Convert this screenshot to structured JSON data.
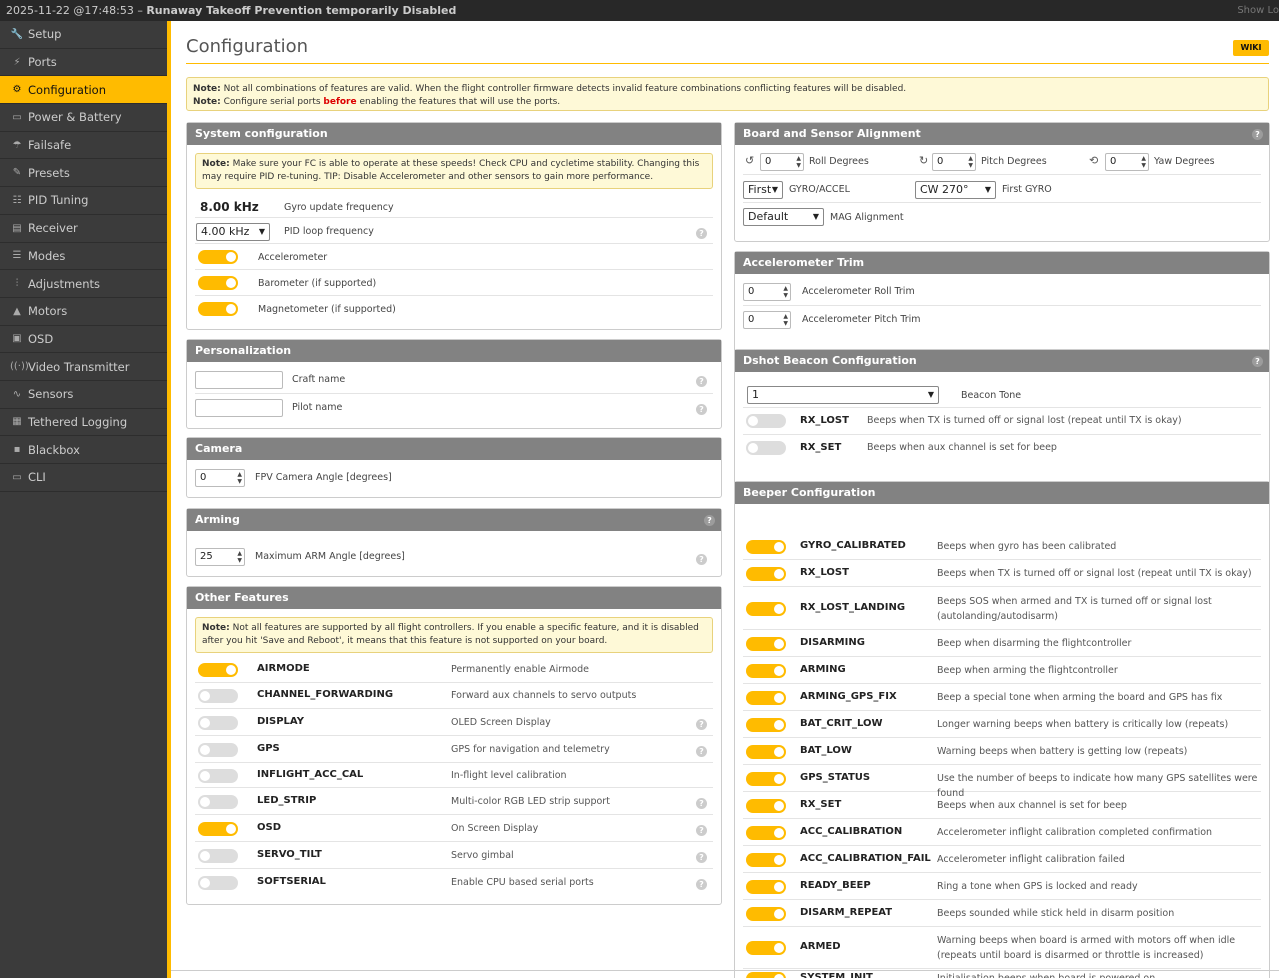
{
  "topbar": {
    "timestamp": "2025-11-22 @17:48:53 –",
    "status": "Runaway Takeoff Prevention temporarily Disabled",
    "show_log": "Show Lo"
  },
  "sidebar": {
    "items": [
      {
        "label": "Setup",
        "icon": "wrench-icon",
        "glyph": "🔧"
      },
      {
        "label": "Ports",
        "icon": "plug-icon",
        "glyph": "⚡"
      },
      {
        "label": "Configuration",
        "icon": "gear-icon",
        "glyph": "⚙"
      },
      {
        "label": "Power & Battery",
        "icon": "battery-icon",
        "glyph": "▭"
      },
      {
        "label": "Failsafe",
        "icon": "parachute-icon",
        "glyph": "☂"
      },
      {
        "label": "Presets",
        "icon": "magic-wand-icon",
        "glyph": "✎"
      },
      {
        "label": "PID Tuning",
        "icon": "sitemap-icon",
        "glyph": "☷"
      },
      {
        "label": "Receiver",
        "icon": "receiver-icon",
        "glyph": "▤"
      },
      {
        "label": "Modes",
        "icon": "modes-icon",
        "glyph": "☰"
      },
      {
        "label": "Adjustments",
        "icon": "sliders-icon",
        "glyph": "⫶"
      },
      {
        "label": "Motors",
        "icon": "motor-icon",
        "glyph": "▲"
      },
      {
        "label": "OSD",
        "icon": "osd-icon",
        "glyph": "▣"
      },
      {
        "label": "Video Transmitter",
        "icon": "broadcast-icon",
        "glyph": "((·))"
      },
      {
        "label": "Sensors",
        "icon": "pulse-icon",
        "glyph": "∿"
      },
      {
        "label": "Tethered Logging",
        "icon": "logging-icon",
        "glyph": "▦"
      },
      {
        "label": "Blackbox",
        "icon": "blackbox-icon",
        "glyph": "▪"
      },
      {
        "label": "CLI",
        "icon": "terminal-icon",
        "glyph": "▭"
      }
    ],
    "active_index": 2
  },
  "page": {
    "title": "Configuration",
    "wiki": "WIKI",
    "note1_bold": "Note:",
    "note1": "Not all combinations of features are valid. When the flight controller firmware detects invalid feature combinations conflicting features will be disabled.",
    "note2_bold": "Note:",
    "note2_pre": "Configure serial ports",
    "note2_red": "before",
    "note2_post": "enabling the features that will use the ports."
  },
  "system": {
    "title": "System configuration",
    "note_bold": "Note:",
    "note": "Make sure your FC is able to operate at these speeds! Check CPU and cycletime stability. Changing this may require PID re-tuning. TIP: Disable Accelerometer and other sensors to gain more performance.",
    "gyro_value": "8.00 kHz",
    "gyro_label": "Gyro update frequency",
    "pid_value": "4.00 kHz",
    "pid_label": "PID loop frequency",
    "toggles": [
      {
        "label": "Accelerometer",
        "on": true
      },
      {
        "label": "Barometer (if supported)",
        "on": true
      },
      {
        "label": "Magnetometer (if supported)",
        "on": true
      }
    ]
  },
  "personalization": {
    "title": "Personalization",
    "craft_label": "Craft name",
    "pilot_label": "Pilot name",
    "craft_value": "",
    "pilot_value": ""
  },
  "camera": {
    "title": "Camera",
    "value": "0",
    "label": "FPV Camera Angle [degrees]"
  },
  "arming": {
    "title": "Arming",
    "value": "25",
    "label": "Maximum ARM Angle [degrees]"
  },
  "features": {
    "title": "Other Features",
    "note_bold": "Note:",
    "note": "Not all features are supported by all flight controllers. If you enable a specific feature, and it is disabled after you hit 'Save and Reboot', it means that this feature is not supported on your board.",
    "items": [
      {
        "name": "AIRMODE",
        "desc": "Permanently enable Airmode",
        "on": true,
        "help": false
      },
      {
        "name": "CHANNEL_FORWARDING",
        "desc": "Forward aux channels to servo outputs",
        "on": false,
        "help": false
      },
      {
        "name": "DISPLAY",
        "desc": "OLED Screen Display",
        "on": false,
        "help": true
      },
      {
        "name": "GPS",
        "desc": "GPS for navigation and telemetry",
        "on": false,
        "help": true
      },
      {
        "name": "INFLIGHT_ACC_CAL",
        "desc": "In-flight level calibration",
        "on": false,
        "help": false
      },
      {
        "name": "LED_STRIP",
        "desc": "Multi-color RGB LED strip support",
        "on": false,
        "help": true
      },
      {
        "name": "OSD",
        "desc": "On Screen Display",
        "on": true,
        "help": true
      },
      {
        "name": "SERVO_TILT",
        "desc": "Servo gimbal",
        "on": false,
        "help": true
      },
      {
        "name": "SOFTSERIAL",
        "desc": "Enable CPU based serial ports",
        "on": false,
        "help": true
      }
    ]
  },
  "alignment": {
    "title": "Board and Sensor Alignment",
    "roll_value": "0",
    "roll_label": "Roll Degrees",
    "pitch_value": "0",
    "pitch_label": "Pitch Degrees",
    "yaw_value": "0",
    "yaw_label": "Yaw Degrees",
    "gyro_select": "First",
    "gyro_label": "GYRO/ACCEL",
    "first_gyro_select": "CW 270°",
    "first_gyro_label": "First GYRO",
    "mag_select": "Default",
    "mag_label": "MAG Alignment"
  },
  "acc_trim": {
    "title": "Accelerometer Trim",
    "roll_value": "0",
    "roll_label": "Accelerometer Roll Trim",
    "pitch_value": "0",
    "pitch_label": "Accelerometer Pitch Trim"
  },
  "dshot": {
    "title": "Dshot Beacon Configuration",
    "tone_value": "1",
    "tone_label": "Beacon Tone",
    "items": [
      {
        "name": "RX_LOST",
        "desc": "Beeps when TX is turned off or signal lost (repeat until TX is okay)",
        "on": false
      },
      {
        "name": "RX_SET",
        "desc": "Beeps when aux channel is set for beep",
        "on": false
      }
    ]
  },
  "beeper": {
    "title": "Beeper Configuration",
    "items": [
      {
        "name": "GYRO_CALIBRATED",
        "desc": "Beeps when gyro has been calibrated",
        "on": true
      },
      {
        "name": "RX_LOST",
        "desc": "Beeps when TX is turned off or signal lost (repeat until TX is okay)",
        "on": true
      },
      {
        "name": "RX_LOST_LANDING",
        "desc": "Beeps SOS when armed and TX is turned off or signal lost (autolanding/autodisarm)",
        "on": true
      },
      {
        "name": "DISARMING",
        "desc": "Beep when disarming the flightcontroller",
        "on": true
      },
      {
        "name": "ARMING",
        "desc": "Beep when arming the flightcontroller",
        "on": true
      },
      {
        "name": "ARMING_GPS_FIX",
        "desc": "Beep a special tone when arming the board and GPS has fix",
        "on": true
      },
      {
        "name": "BAT_CRIT_LOW",
        "desc": "Longer warning beeps when battery is critically low (repeats)",
        "on": true
      },
      {
        "name": "BAT_LOW",
        "desc": "Warning beeps when battery is getting low (repeats)",
        "on": true
      },
      {
        "name": "GPS_STATUS",
        "desc": "Use the number of beeps to indicate how many GPS satellites were found",
        "on": true
      },
      {
        "name": "RX_SET",
        "desc": "Beeps when aux channel is set for beep",
        "on": true
      },
      {
        "name": "ACC_CALIBRATION",
        "desc": "Accelerometer inflight calibration completed confirmation",
        "on": true
      },
      {
        "name": "ACC_CALIBRATION_FAIL",
        "desc": "Accelerometer inflight calibration failed",
        "on": true
      },
      {
        "name": "READY_BEEP",
        "desc": "Ring a tone when GPS is locked and ready",
        "on": true
      },
      {
        "name": "DISARM_REPEAT",
        "desc": "Beeps sounded while stick held in disarm position",
        "on": true
      },
      {
        "name": "ARMED",
        "desc": "Warning beeps when board is armed with motors off when idle (repeats until board is disarmed or throttle is increased)",
        "on": true
      },
      {
        "name": "SYSTEM_INIT",
        "desc": "Initialisation beeps when board is powered on",
        "on": true
      }
    ]
  },
  "colors": {
    "accent": "#ffbb00",
    "sidebar": "#3b3b3b",
    "header": "#828282",
    "note_bg": "#fef9d7"
  }
}
